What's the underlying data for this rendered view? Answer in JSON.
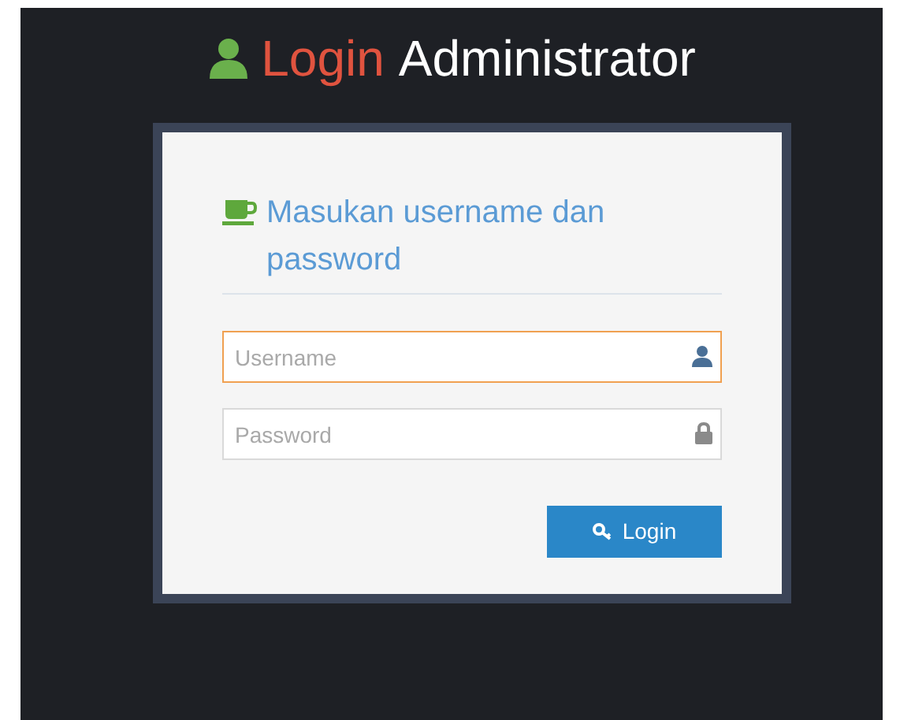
{
  "title": {
    "accent": "Login",
    "rest": "Administrator"
  },
  "panel": {
    "heading": "Masukan username dan password"
  },
  "fields": [
    {
      "kind": "text",
      "placeholder": "Username",
      "focused": true
    },
    {
      "kind": "password",
      "placeholder": "Password",
      "focused": false
    }
  ],
  "button": {
    "label": "Login"
  }
}
